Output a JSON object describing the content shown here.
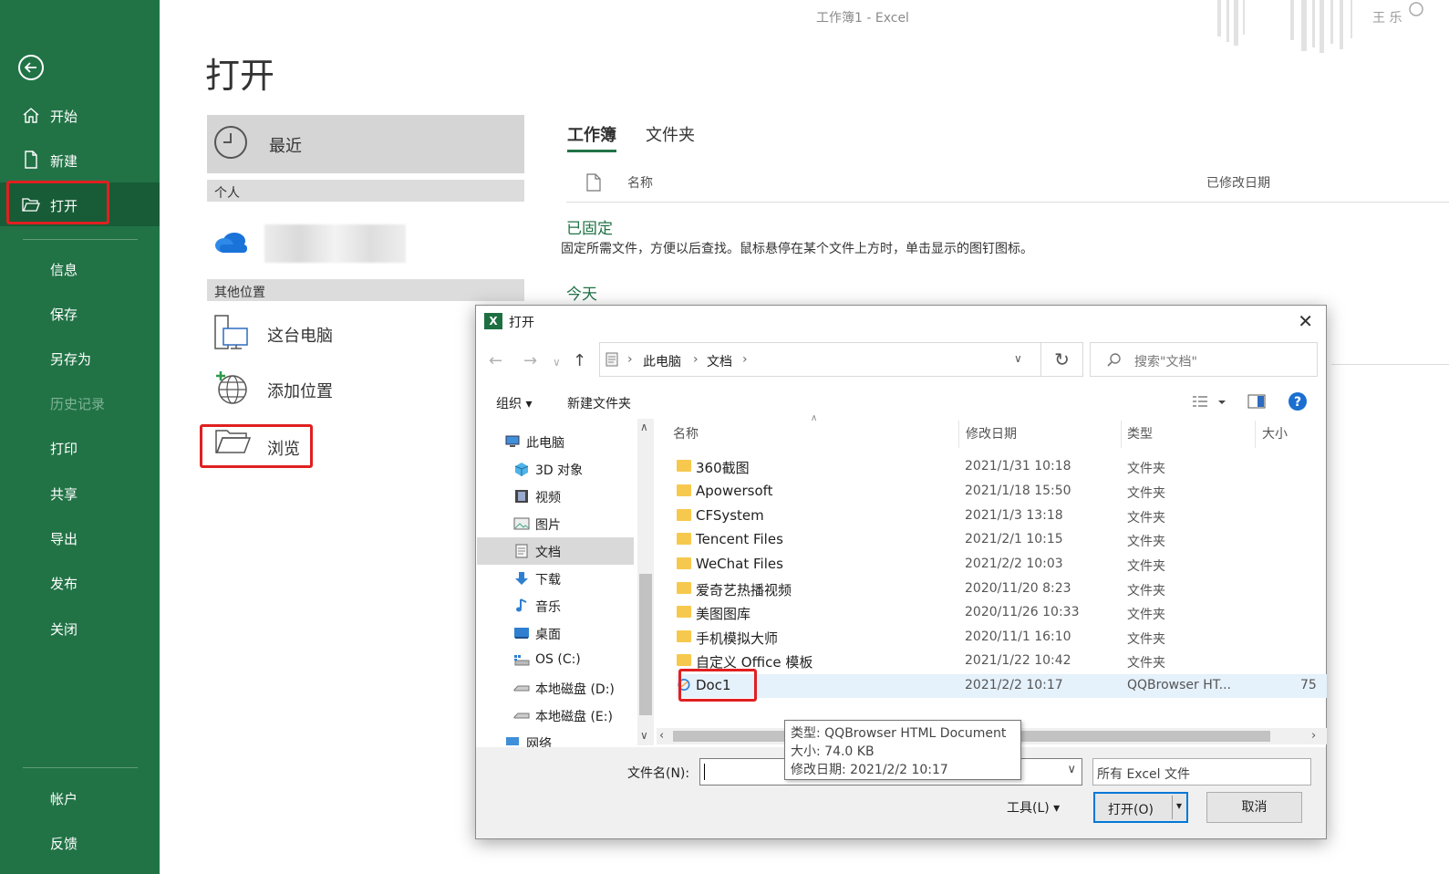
{
  "window": {
    "title": "工作簿1  -  Excel",
    "user": "王 乐"
  },
  "nav": {
    "items": [
      {
        "label": "开始"
      },
      {
        "label": "新建"
      },
      {
        "label": "打开"
      },
      {
        "label": "信息"
      },
      {
        "label": "保存"
      },
      {
        "label": "另存为"
      },
      {
        "label": "历史记录"
      },
      {
        "label": "打印"
      },
      {
        "label": "共享"
      },
      {
        "label": "导出"
      },
      {
        "label": "发布"
      },
      {
        "label": "关闭"
      },
      {
        "label": "帐户"
      },
      {
        "label": "反馈"
      }
    ]
  },
  "backstage": {
    "title": "打开",
    "recent": "最近",
    "personal_header": "个人",
    "other_header": "其他位置",
    "this_pc": "这台电脑",
    "add_location": "添加位置",
    "browse": "浏览",
    "tabs": [
      "工作簿",
      "文件夹"
    ],
    "col_name": "名称",
    "col_modified": "已修改日期",
    "pinned_title": "已固定",
    "pinned_hint": "固定所需文件，方便以后查找。鼠标悬停在某个文件上方时，单击显示的图钉图标。",
    "today": "今天"
  },
  "dialog": {
    "title": "打开",
    "breadcrumb": [
      "此电脑",
      "文档"
    ],
    "search_placeholder": "搜索\"文档\"",
    "organize": "组织",
    "new_folder": "新建文件夹",
    "tree": [
      {
        "label": "此电脑",
        "icon": "computer-icon"
      },
      {
        "label": "3D 对象",
        "icon": "3d-objects-icon"
      },
      {
        "label": "视频",
        "icon": "video-icon"
      },
      {
        "label": "图片",
        "icon": "pictures-icon"
      },
      {
        "label": "文档",
        "icon": "documents-icon"
      },
      {
        "label": "下载",
        "icon": "download-icon"
      },
      {
        "label": "音乐",
        "icon": "music-icon"
      },
      {
        "label": "桌面",
        "icon": "desktop-icon"
      },
      {
        "label": "OS (C:)",
        "icon": "drive-icon"
      },
      {
        "label": "本地磁盘 (D:)",
        "icon": "drive-icon"
      },
      {
        "label": "本地磁盘 (E:)",
        "icon": "drive-icon"
      },
      {
        "label": "网络",
        "icon": "network-icon"
      }
    ],
    "columns": {
      "name": "名称",
      "date": "修改日期",
      "type": "类型",
      "size": "大小"
    },
    "files": [
      {
        "name": "360截图",
        "date": "2021/1/31 10:18",
        "type": "文件夹",
        "size": ""
      },
      {
        "name": "Apowersoft",
        "date": "2021/1/18 15:50",
        "type": "文件夹",
        "size": ""
      },
      {
        "name": "CFSystem",
        "date": "2021/1/3 13:18",
        "type": "文件夹",
        "size": ""
      },
      {
        "name": "Tencent Files",
        "date": "2021/2/1 10:15",
        "type": "文件夹",
        "size": ""
      },
      {
        "name": "WeChat Files",
        "date": "2021/2/2 10:03",
        "type": "文件夹",
        "size": ""
      },
      {
        "name": "爱奇艺热播视频",
        "date": "2020/11/20 8:23",
        "type": "文件夹",
        "size": ""
      },
      {
        "name": "美图图库",
        "date": "2020/11/26 10:33",
        "type": "文件夹",
        "size": ""
      },
      {
        "name": "手机模拟大师",
        "date": "2020/11/1 16:10",
        "type": "文件夹",
        "size": ""
      },
      {
        "name": "自定义 Office 模板",
        "date": "2021/1/22 10:42",
        "type": "文件夹",
        "size": ""
      },
      {
        "name": "Doc1",
        "date": "2021/2/2 10:17",
        "type": "QQBrowser HT...",
        "size": "75"
      }
    ],
    "tooltip": {
      "line1": "类型: QQBrowser HTML Document",
      "line2": "大小: 74.0 KB",
      "line3": "修改日期: 2021/2/2 10:17"
    },
    "filename_label": "文件名(N):",
    "filter_value": "所有 Excel 文件",
    "tools": "工具(L)",
    "open_btn": "打开(O)",
    "cancel_btn": "取消"
  },
  "colors": {
    "excel_green": "#217346",
    "highlight_red": "#e02020"
  }
}
